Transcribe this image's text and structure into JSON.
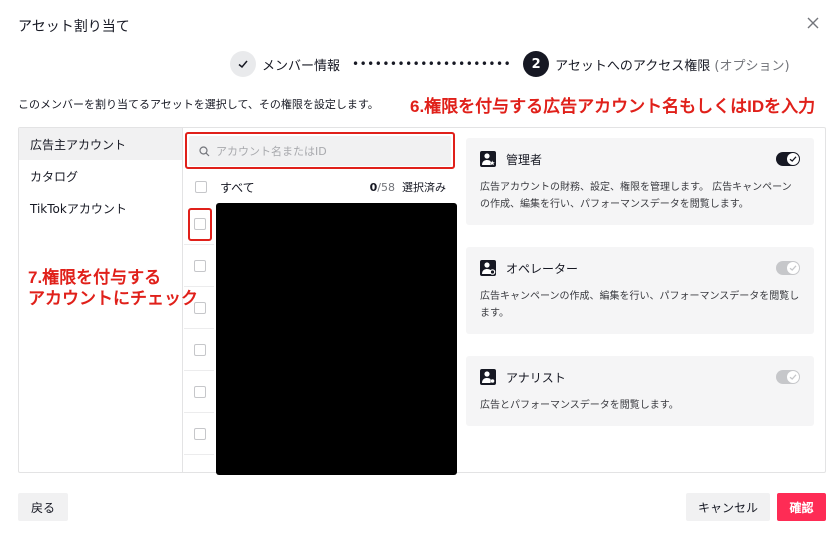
{
  "dialog": {
    "title": "アセット割り当て"
  },
  "steps": {
    "step1_label": "メンバー情報",
    "step2_number": "2",
    "step2_label": "アセットへのアクセス権限",
    "step2_optional": "(オプション)",
    "dots": "•••••••••••••••••••••"
  },
  "description": "このメンバーを割り当てるアセットを選択して、その権限を設定します。",
  "annotations": {
    "search_note": "6.権限を付与する広告アカウント名もしくはIDを入力",
    "check_note_line1": "7.権限を付与する",
    "check_note_line2": "アカウントにチェック",
    "color": "#e0201a"
  },
  "asset_types": [
    {
      "label": "広告主アカウント",
      "active": true
    },
    {
      "label": "カタログ",
      "active": false
    },
    {
      "label": "TikTokアカウント",
      "active": false
    }
  ],
  "search": {
    "placeholder": "アカウント名またはID",
    "value": ""
  },
  "select_all": {
    "label": "すべて",
    "selected": "0",
    "total": "/58",
    "suffix": "選択済み"
  },
  "roles": [
    {
      "name": "管理者",
      "enabled": true,
      "description": "広告アカウントの財務、設定、権限を管理します。 広告キャンペーンの作成、編集を行い、パフォーマンスデータを閲覧します。"
    },
    {
      "name": "オペレーター",
      "enabled": false,
      "description": "広告キャンペーンの作成、編集を行い、パフォーマンスデータを閲覧します。"
    },
    {
      "name": "アナリスト",
      "enabled": false,
      "description": "広告とパフォーマンスデータを閲覧します。"
    }
  ],
  "buttons": {
    "back": "戻る",
    "cancel": "キャンセル",
    "confirm": "確認"
  },
  "colors": {
    "accent": "#fe2c55",
    "dark": "#161823",
    "annotation": "#e0201a"
  }
}
